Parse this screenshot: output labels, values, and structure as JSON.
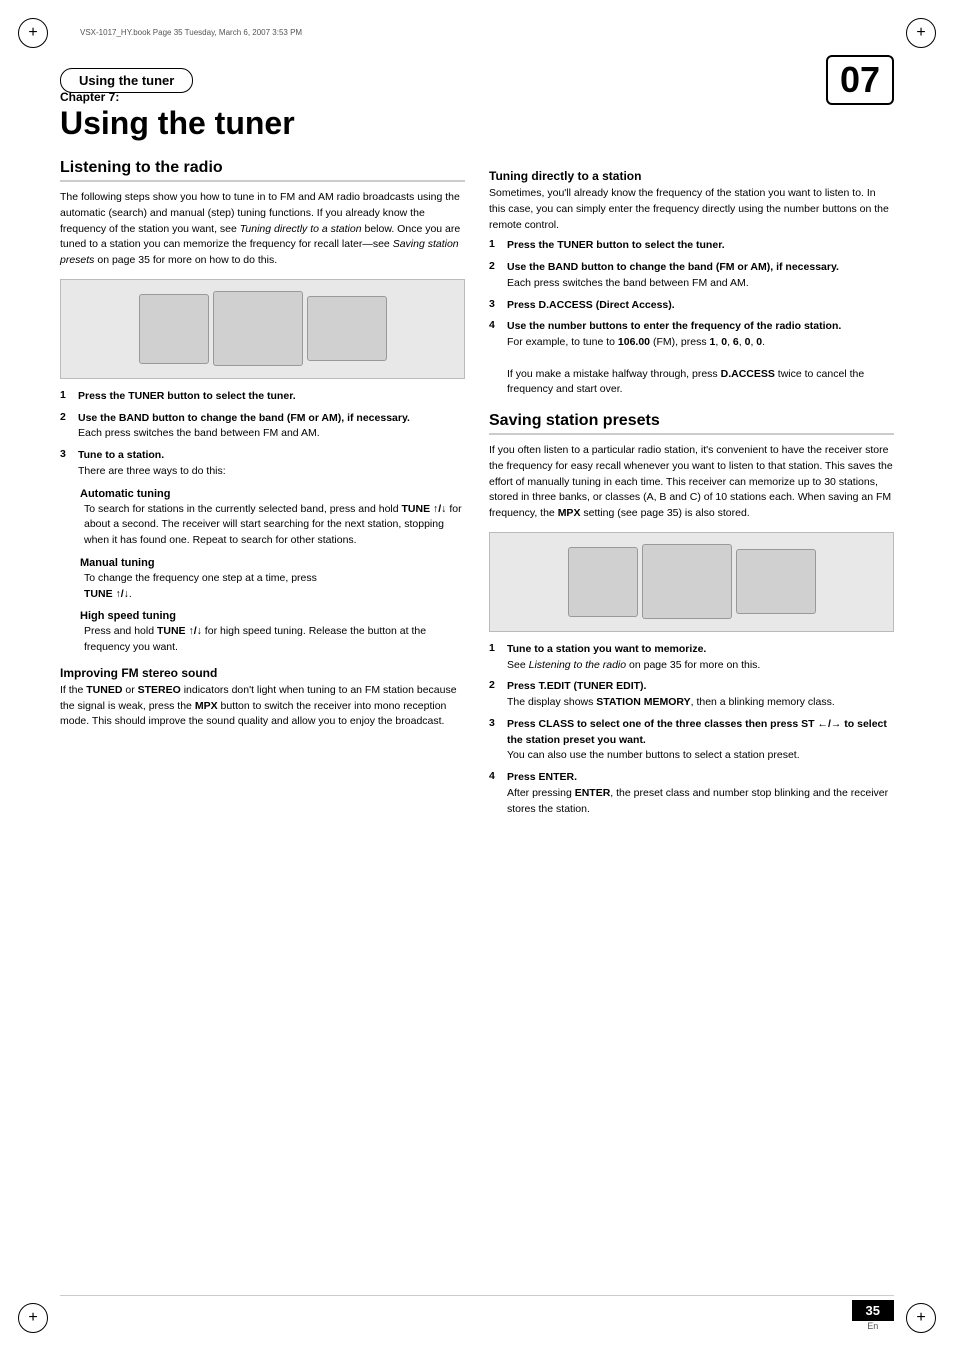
{
  "meta": {
    "small_print": "VSX-1017_HY.book  Page 35  Tuesday, March 6, 2007  3:53 PM"
  },
  "header": {
    "tab_label": "Using the tuner",
    "chapter_number": "07"
  },
  "chapter": {
    "label": "Chapter 7:",
    "title": "Using the tuner"
  },
  "left_col": {
    "listening_heading": "Listening to the radio",
    "listening_intro": "The following steps show you how to tune in to FM and AM radio broadcasts using the automatic (search) and manual (step) tuning functions. If you already know the frequency of the station you want, see Tuning directly to a station below. Once you are tuned to a station you can memorize the frequency for recall later—see Saving station presets on page 35 for more on how to do this.",
    "steps": [
      {
        "num": "1",
        "text": "Press the TUNER button to select the tuner."
      },
      {
        "num": "2",
        "text": "Use the BAND button to change the band (FM or AM), if necessary.",
        "note": "Each press switches the band between FM and AM."
      },
      {
        "num": "3",
        "text": "Tune to a station.",
        "note": "There are three ways to do this:"
      }
    ],
    "auto_tuning_heading": "Automatic tuning",
    "auto_tuning_text": "To search for stations in the currently selected band, press and hold TUNE ↑/↓ for about a second. The receiver will start searching for the next station, stopping when it has found one. Repeat to search for other stations.",
    "manual_tuning_heading": "Manual tuning",
    "manual_tuning_text": "To change the frequency one step at a time, press TUNE ↑/↓.",
    "high_speed_heading": "High speed tuning",
    "high_speed_text": "Press and hold TUNE ↑/↓ for high speed tuning. Release the button at the frequency you want.",
    "improving_heading": "Improving FM stereo sound",
    "improving_text": "If the TUNED or STEREO indicators don't light when tuning to an FM station because the signal is weak, press the MPX button to switch the receiver into mono reception mode. This should improve the sound quality and allow you to enjoy the broadcast."
  },
  "right_col": {
    "tuning_directly_heading": "Tuning directly to a station",
    "tuning_directly_intro": "Sometimes, you'll already know the frequency of the station you want to listen to. In this case, you can simply enter the frequency directly using the number buttons on the remote control.",
    "tuning_steps": [
      {
        "num": "1",
        "text": "Press the TUNER button to select the tuner."
      },
      {
        "num": "2",
        "text": "Use the BAND button to change the band (FM or AM), if necessary.",
        "note": "Each press switches the band between FM and AM."
      },
      {
        "num": "3",
        "text": "Press D.ACCESS (Direct Access)."
      },
      {
        "num": "4",
        "text": "Use the number buttons to enter the frequency of the radio station.",
        "note_bold": "For example, to tune to 106.00 (FM), press 1, 0, 6, 0, 0.",
        "note2": "If you make a mistake halfway through, press D.ACCESS twice to cancel the frequency and start over."
      }
    ],
    "saving_heading": "Saving station presets",
    "saving_intro": "If you often listen to a particular radio station, it's convenient to have the receiver store the frequency for easy recall whenever you want to listen to that station. This saves the effort of manually tuning in each time. This receiver can memorize up to 30 stations, stored in three banks, or classes (A, B and C) of 10 stations each. When saving an FM frequency, the MPX setting (see page 35) is also stored.",
    "saving_steps": [
      {
        "num": "1",
        "text": "Tune to a station you want to memorize.",
        "note": "See Listening to the radio on page 35 for more on this."
      },
      {
        "num": "2",
        "text": "Press T.EDIT (TUNER EDIT).",
        "note": "The display shows STATION MEMORY, then a blinking memory class."
      },
      {
        "num": "3",
        "text": "Press CLASS to select one of the three classes then press ST ←/→ to select the station preset you want.",
        "note": "You can also use the number buttons to select a station preset."
      },
      {
        "num": "4",
        "text": "Press ENTER.",
        "note": "After pressing ENTER, the preset class and number stop blinking and the receiver stores the station."
      }
    ]
  },
  "page": {
    "number": "35",
    "lang": "En"
  }
}
